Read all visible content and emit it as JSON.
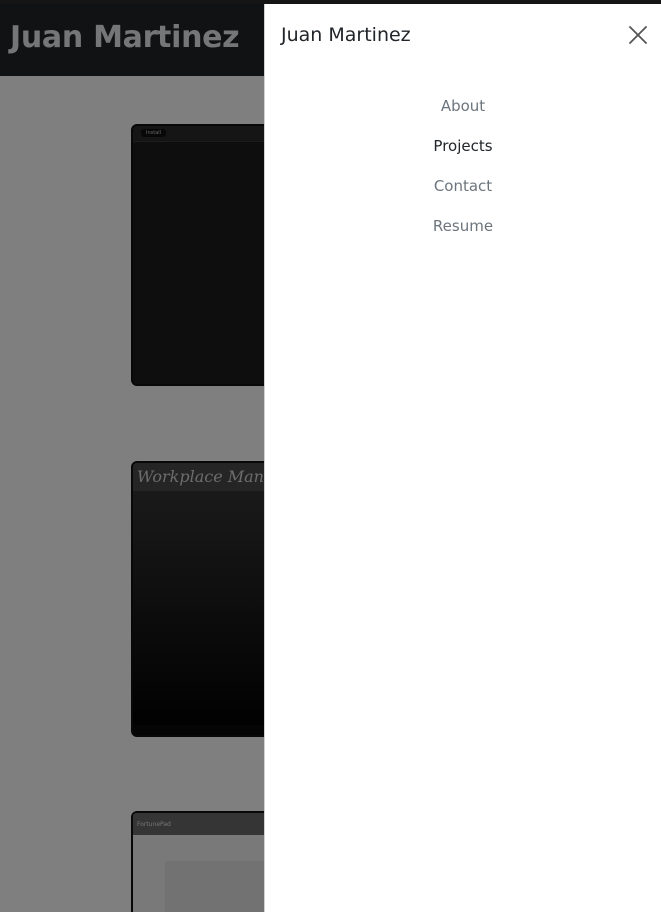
{
  "site": {
    "title": "Juan Martinez",
    "projects": [
      {
        "badge": "Install"
      },
      {
        "heading": "Workplace Manag"
      },
      {
        "label": "FortunePad"
      }
    ]
  },
  "drawer": {
    "title": "Juan Martinez",
    "close_icon": "close-icon",
    "nav": [
      {
        "label": "About",
        "active": false
      },
      {
        "label": "Projects",
        "active": true
      },
      {
        "label": "Contact",
        "active": false
      },
      {
        "label": "Resume",
        "active": false
      }
    ]
  },
  "colors": {
    "header_bg": "#212529",
    "backdrop": "rgba(0,0,0,0.5)",
    "nav_text": "#6c757d",
    "nav_active_text": "#212529"
  }
}
